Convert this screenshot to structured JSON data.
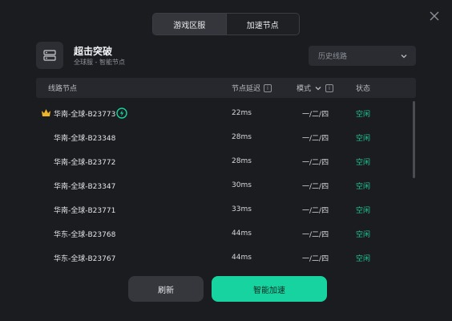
{
  "tabs": [
    {
      "label": "游戏区服",
      "active": true
    },
    {
      "label": "加速节点",
      "active": false
    }
  ],
  "game": {
    "title": "超击突破",
    "subtitle": "全球服 - 智能节点",
    "icon": "server-icon"
  },
  "history": {
    "label": "历史线路"
  },
  "table": {
    "headers": {
      "node": "线路节点",
      "latency": "节点延迟",
      "mode": "模式",
      "status": "状态"
    },
    "rows": [
      {
        "name": "华南-全球-B23773",
        "latency": "22ms",
        "mode": "一/二/四",
        "status": "空闲",
        "crown": true,
        "badge": true
      },
      {
        "name": "华南-全球-B23348",
        "latency": "28ms",
        "mode": "一/二/四",
        "status": "空闲"
      },
      {
        "name": "华南-全球-B23772",
        "latency": "28ms",
        "mode": "一/二/四",
        "status": "空闲"
      },
      {
        "name": "华南-全球-B23347",
        "latency": "30ms",
        "mode": "一/二/四",
        "status": "空闲"
      },
      {
        "name": "华南-全球-B23771",
        "latency": "33ms",
        "mode": "一/二/四",
        "status": "空闲"
      },
      {
        "name": "华东-全球-B23768",
        "latency": "44ms",
        "mode": "一/二/四",
        "status": "空闲"
      },
      {
        "name": "华东-全球-B23767",
        "latency": "44ms",
        "mode": "一/二/四",
        "status": "空闲"
      }
    ]
  },
  "buttons": {
    "refresh": "刷新",
    "accelerate": "智能加速"
  },
  "colors": {
    "accent": "#17d3a0",
    "status_idle": "#1fc594",
    "background": "#1b1c20"
  }
}
